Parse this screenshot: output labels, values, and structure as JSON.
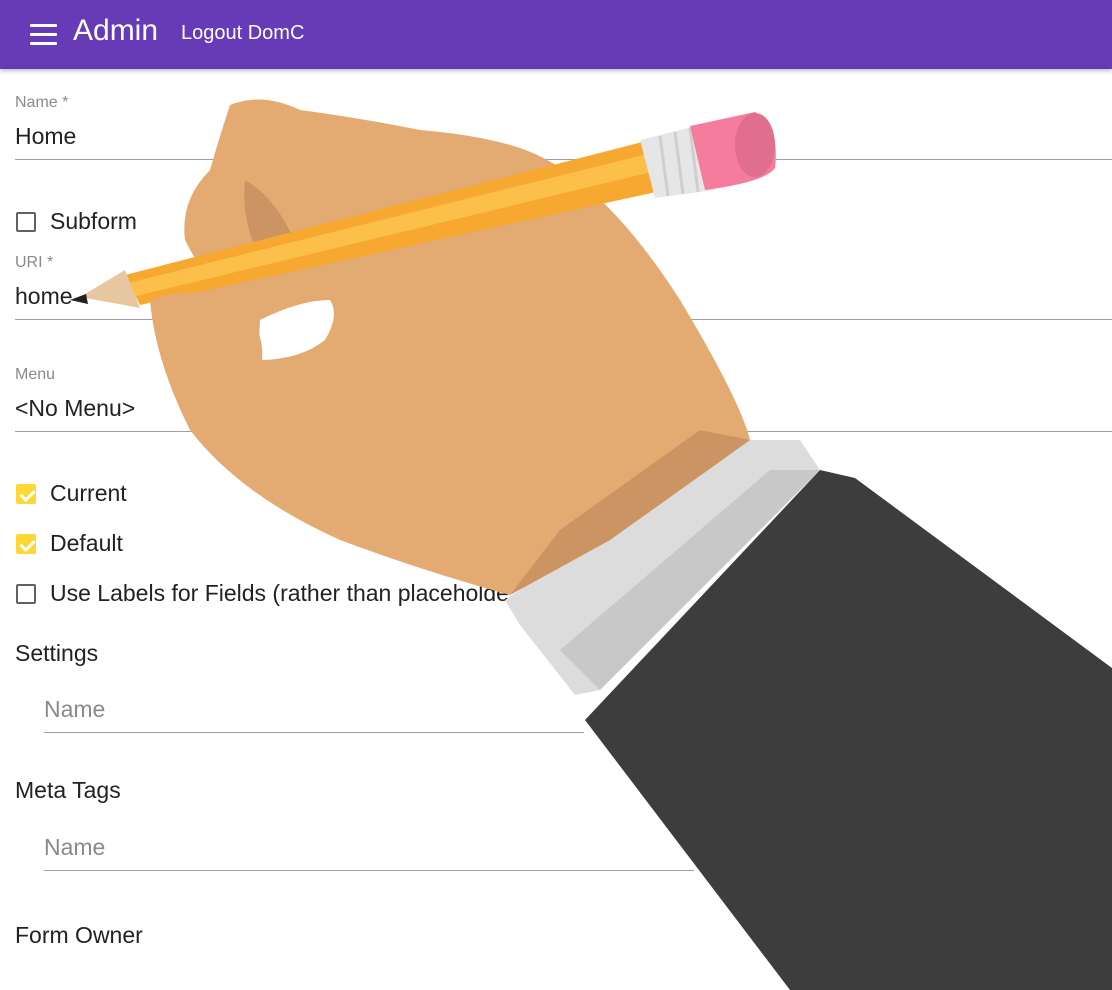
{
  "header": {
    "title": "Admin",
    "logout_label": "Logout DomC",
    "color": "#673ab7"
  },
  "form": {
    "name": {
      "label": "Name *",
      "value": "Home"
    },
    "subform": {
      "label": "Subform",
      "checked": false
    },
    "uri": {
      "label": "URI *",
      "value": "home"
    },
    "menu": {
      "label": "Menu",
      "value": "<No Menu>"
    },
    "current": {
      "label": "Current",
      "checked": true
    },
    "default": {
      "label": "Default",
      "checked": true
    },
    "use_labels": {
      "label": "Use Labels for Fields (rather than placeholde",
      "checked": false
    },
    "settings": {
      "title": "Settings",
      "name_placeholder": "Name"
    },
    "meta_tags": {
      "title": "Meta Tags",
      "name_placeholder": "Name"
    },
    "form_owner": {
      "title": "Form Owner"
    }
  },
  "colors": {
    "checkbox_checked": "#fdd835"
  },
  "icons": [
    "menu-icon",
    "checkbox-icon"
  ],
  "illustration": "hand-writing-with-pencil"
}
